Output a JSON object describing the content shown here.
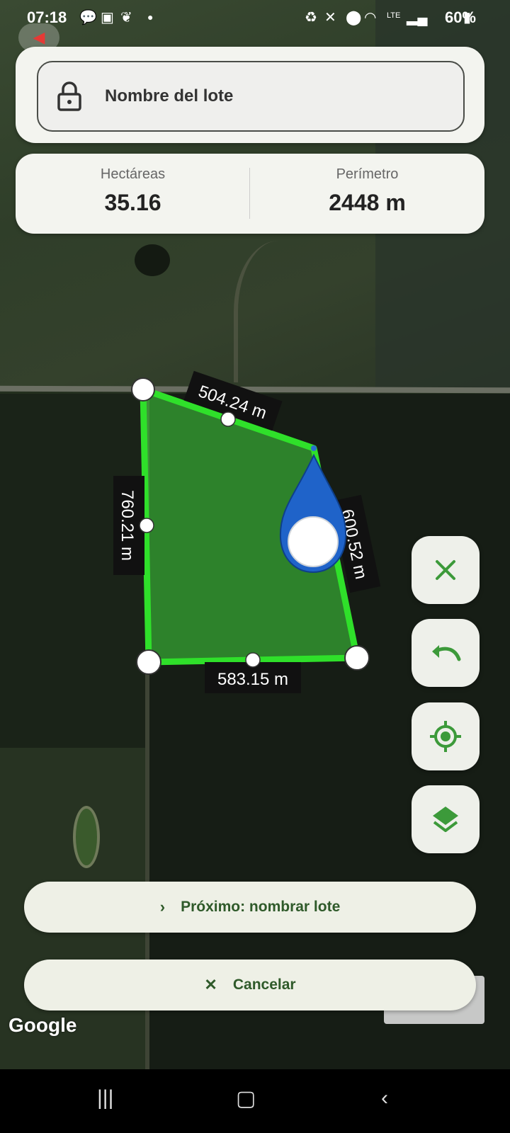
{
  "status_bar": {
    "time": "07:18",
    "battery": "60%",
    "icons": [
      "message-icon",
      "image-icon",
      "leaf-icon",
      "dot-icon",
      "recycle-icon",
      "mute-icon",
      "location-icon",
      "wifi-icon",
      "volte-icon",
      "signal-icon",
      "battery-icon"
    ]
  },
  "name_field": {
    "placeholder": "Nombre del lote",
    "icon": "lock-icon"
  },
  "stats": {
    "area_label": "Hectáreas",
    "area_value": "35.16",
    "perimeter_label": "Perímetro",
    "perimeter_value": "2448 m"
  },
  "polygon": {
    "fill_color": "#3ec63a",
    "stroke_color": "#36e02e",
    "edges": [
      "504.24 m",
      "600.52 m",
      "583.15 m",
      "760.21 m"
    ]
  },
  "fab_buttons": [
    {
      "name": "close-icon"
    },
    {
      "name": "undo-icon"
    },
    {
      "name": "my-location-icon"
    },
    {
      "name": "layers-icon"
    }
  ],
  "actions": {
    "next_label": "Próximo: nombrar lote",
    "next_icon": "chevron-right-icon",
    "cancel_label": "Cancelar",
    "cancel_icon": "close-icon"
  },
  "map": {
    "logo": "Google"
  },
  "colors": {
    "accent": "#3c9a3a",
    "card_bg": "#f3f4ef",
    "pill_bg": "#eef0e6"
  }
}
